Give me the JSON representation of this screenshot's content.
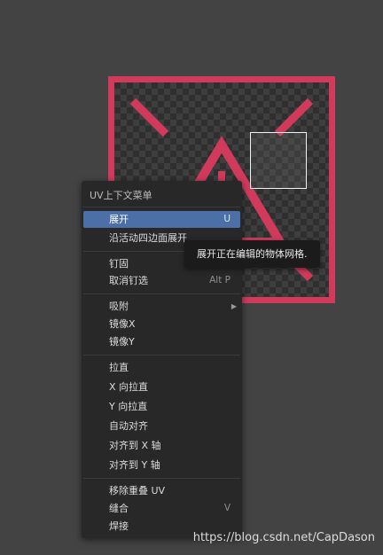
{
  "colors": {
    "background": "#434343",
    "uv_border": "#d23a5c",
    "menu_bg": "#282828",
    "menu_active": "#4b6fa6",
    "tooltip_bg": "#1b1b1b"
  },
  "viewport": {
    "uv_texture_icon": "warning-triangle-icon"
  },
  "menu": {
    "title": "UV上下文菜单",
    "groups": [
      {
        "items": [
          {
            "label": "展开",
            "shortcut": "U",
            "active": true
          },
          {
            "label": "沿活动四边面展开",
            "shortcut": ""
          }
        ]
      },
      {
        "items": [
          {
            "label": "钉固",
            "shortcut": ""
          },
          {
            "label": "取消钉选",
            "shortcut": "Alt P"
          }
        ]
      },
      {
        "items": [
          {
            "label": "吸附",
            "shortcut": "",
            "submenu": true
          },
          {
            "label": "镜像X",
            "shortcut": ""
          },
          {
            "label": "镜像Y",
            "shortcut": ""
          }
        ]
      },
      {
        "items": [
          {
            "label": "拉直",
            "shortcut": ""
          },
          {
            "label": "X 向拉直",
            "shortcut": ""
          },
          {
            "label": "Y 向拉直",
            "shortcut": ""
          },
          {
            "label": "自动对齐",
            "shortcut": ""
          },
          {
            "label": "对齐到 X 轴",
            "shortcut": ""
          },
          {
            "label": "对齐到 Y 轴",
            "shortcut": ""
          }
        ]
      },
      {
        "items": [
          {
            "label": "移除重叠 UV",
            "shortcut": ""
          },
          {
            "label": "缝合",
            "shortcut": "V"
          },
          {
            "label": "焊接",
            "shortcut": ""
          }
        ]
      }
    ]
  },
  "tooltip": {
    "text": "展开正在编辑的物体网格."
  },
  "watermark": "https://blog.csdn.net/CapDason"
}
